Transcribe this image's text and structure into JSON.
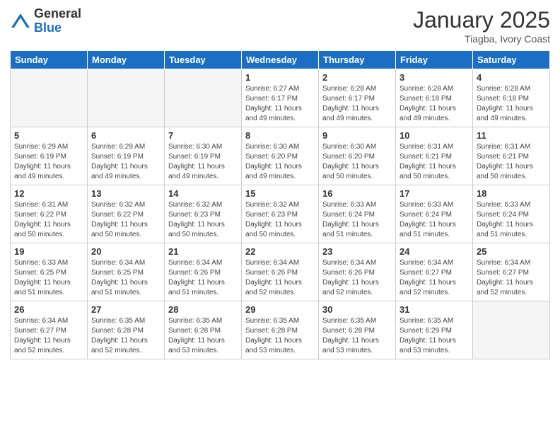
{
  "logo": {
    "general": "General",
    "blue": "Blue"
  },
  "header": {
    "month": "January 2025",
    "location": "Tiagba, Ivory Coast"
  },
  "weekdays": [
    "Sunday",
    "Monday",
    "Tuesday",
    "Wednesday",
    "Thursday",
    "Friday",
    "Saturday"
  ],
  "weeks": [
    [
      {
        "day": "",
        "info": ""
      },
      {
        "day": "",
        "info": ""
      },
      {
        "day": "",
        "info": ""
      },
      {
        "day": "1",
        "info": "Sunrise: 6:27 AM\nSunset: 6:17 PM\nDaylight: 11 hours and 49 minutes."
      },
      {
        "day": "2",
        "info": "Sunrise: 6:28 AM\nSunset: 6:17 PM\nDaylight: 11 hours and 49 minutes."
      },
      {
        "day": "3",
        "info": "Sunrise: 6:28 AM\nSunset: 6:18 PM\nDaylight: 11 hours and 49 minutes."
      },
      {
        "day": "4",
        "info": "Sunrise: 6:28 AM\nSunset: 6:18 PM\nDaylight: 11 hours and 49 minutes."
      }
    ],
    [
      {
        "day": "5",
        "info": "Sunrise: 6:29 AM\nSunset: 6:19 PM\nDaylight: 11 hours and 49 minutes."
      },
      {
        "day": "6",
        "info": "Sunrise: 6:29 AM\nSunset: 6:19 PM\nDaylight: 11 hours and 49 minutes."
      },
      {
        "day": "7",
        "info": "Sunrise: 6:30 AM\nSunset: 6:19 PM\nDaylight: 11 hours and 49 minutes."
      },
      {
        "day": "8",
        "info": "Sunrise: 6:30 AM\nSunset: 6:20 PM\nDaylight: 11 hours and 49 minutes."
      },
      {
        "day": "9",
        "info": "Sunrise: 6:30 AM\nSunset: 6:20 PM\nDaylight: 11 hours and 50 minutes."
      },
      {
        "day": "10",
        "info": "Sunrise: 6:31 AM\nSunset: 6:21 PM\nDaylight: 11 hours and 50 minutes."
      },
      {
        "day": "11",
        "info": "Sunrise: 6:31 AM\nSunset: 6:21 PM\nDaylight: 11 hours and 50 minutes."
      }
    ],
    [
      {
        "day": "12",
        "info": "Sunrise: 6:31 AM\nSunset: 6:22 PM\nDaylight: 11 hours and 50 minutes."
      },
      {
        "day": "13",
        "info": "Sunrise: 6:32 AM\nSunset: 6:22 PM\nDaylight: 11 hours and 50 minutes."
      },
      {
        "day": "14",
        "info": "Sunrise: 6:32 AM\nSunset: 6:23 PM\nDaylight: 11 hours and 50 minutes."
      },
      {
        "day": "15",
        "info": "Sunrise: 6:32 AM\nSunset: 6:23 PM\nDaylight: 11 hours and 50 minutes."
      },
      {
        "day": "16",
        "info": "Sunrise: 6:33 AM\nSunset: 6:24 PM\nDaylight: 11 hours and 51 minutes."
      },
      {
        "day": "17",
        "info": "Sunrise: 6:33 AM\nSunset: 6:24 PM\nDaylight: 11 hours and 51 minutes."
      },
      {
        "day": "18",
        "info": "Sunrise: 6:33 AM\nSunset: 6:24 PM\nDaylight: 11 hours and 51 minutes."
      }
    ],
    [
      {
        "day": "19",
        "info": "Sunrise: 6:33 AM\nSunset: 6:25 PM\nDaylight: 11 hours and 51 minutes."
      },
      {
        "day": "20",
        "info": "Sunrise: 6:34 AM\nSunset: 6:25 PM\nDaylight: 11 hours and 51 minutes."
      },
      {
        "day": "21",
        "info": "Sunrise: 6:34 AM\nSunset: 6:26 PM\nDaylight: 11 hours and 51 minutes."
      },
      {
        "day": "22",
        "info": "Sunrise: 6:34 AM\nSunset: 6:26 PM\nDaylight: 11 hours and 52 minutes."
      },
      {
        "day": "23",
        "info": "Sunrise: 6:34 AM\nSunset: 6:26 PM\nDaylight: 11 hours and 52 minutes."
      },
      {
        "day": "24",
        "info": "Sunrise: 6:34 AM\nSunset: 6:27 PM\nDaylight: 11 hours and 52 minutes."
      },
      {
        "day": "25",
        "info": "Sunrise: 6:34 AM\nSunset: 6:27 PM\nDaylight: 11 hours and 52 minutes."
      }
    ],
    [
      {
        "day": "26",
        "info": "Sunrise: 6:34 AM\nSunset: 6:27 PM\nDaylight: 11 hours and 52 minutes."
      },
      {
        "day": "27",
        "info": "Sunrise: 6:35 AM\nSunset: 6:28 PM\nDaylight: 11 hours and 52 minutes."
      },
      {
        "day": "28",
        "info": "Sunrise: 6:35 AM\nSunset: 6:28 PM\nDaylight: 11 hours and 53 minutes."
      },
      {
        "day": "29",
        "info": "Sunrise: 6:35 AM\nSunset: 6:28 PM\nDaylight: 11 hours and 53 minutes."
      },
      {
        "day": "30",
        "info": "Sunrise: 6:35 AM\nSunset: 6:28 PM\nDaylight: 11 hours and 53 minutes."
      },
      {
        "day": "31",
        "info": "Sunrise: 6:35 AM\nSunset: 6:29 PM\nDaylight: 11 hours and 53 minutes."
      },
      {
        "day": "",
        "info": ""
      }
    ]
  ]
}
